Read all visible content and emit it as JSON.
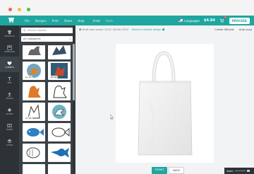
{
  "colors": {
    "accent": "#1fa6a0",
    "dark": "#2d3236",
    "panel": "#3b4146"
  },
  "window": {
    "controls": [
      "close",
      "minimize",
      "maximize"
    ]
  },
  "topbar": {
    "nav": [
      "File",
      "Designs",
      "Print",
      "Share",
      "Help",
      "Undo",
      "Redo"
    ],
    "languages_label": "Languages",
    "price": "$4.84",
    "cart_count": "1",
    "proceed_label": "PROCEED"
  },
  "rail": {
    "items": [
      {
        "label": "PRODUCTS",
        "icon": "tshirt-icon"
      },
      {
        "label": "TEMPLATES",
        "icon": "template-icon"
      },
      {
        "label": "CLIPARTS",
        "icon": "heart-icon"
      },
      {
        "label": "TEXT",
        "icon": "text-icon"
      },
      {
        "label": "UPLOAD",
        "icon": "upload-icon"
      },
      {
        "label": "SHAPES",
        "icon": "shape-icon"
      },
      {
        "label": "NAMES",
        "icon": "names-icon"
      },
      {
        "label": "LAYERS",
        "icon": "layers-icon"
      }
    ]
  },
  "panel": {
    "search_placeholder": "Search cliparts",
    "category_value": "All categories",
    "cliparts": [
      {
        "name": "rabbit"
      },
      {
        "name": "dragon"
      },
      {
        "name": "dragon-crest",
        "tag": "$1.00"
      },
      {
        "name": "griffin-crest",
        "tag": "$1.00"
      },
      {
        "name": "lion"
      },
      {
        "name": "lion-outline"
      },
      {
        "name": "griffin-outline",
        "tag": "$1.00"
      },
      {
        "name": "dragon-head"
      },
      {
        "name": "fish-blue"
      },
      {
        "name": "fish-outline"
      },
      {
        "name": "fish-plain"
      },
      {
        "name": "marlin"
      }
    ]
  },
  "workspace": {
    "save_info": "Draft was saved: 10:21 28 Feb 2024",
    "reset_link": "Reset to default design",
    "tools": [
      "Create QRCode",
      "Auto snap"
    ],
    "buttons": {
      "front": "FRONT",
      "back": "BACK"
    },
    "zoom_label": "Zoom"
  }
}
